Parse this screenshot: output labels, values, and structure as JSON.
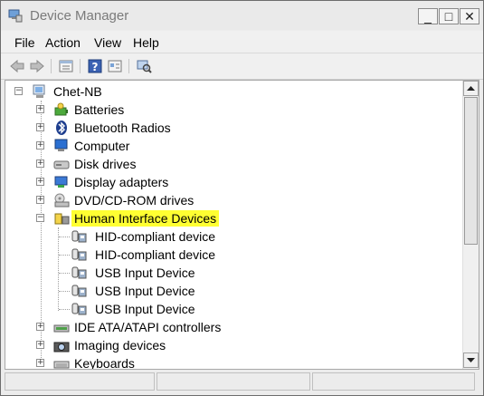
{
  "window": {
    "title": "Device Manager"
  },
  "window_controls": [
    "_",
    "□",
    "✕"
  ],
  "menu": [
    "File",
    "Action",
    "View",
    "Help"
  ],
  "toolbar": [
    "back",
    "forward",
    "properties",
    "help",
    "show-hidden",
    "scan-hardware"
  ],
  "tree": [
    {
      "label": "Chet-NB",
      "level": 0,
      "expander": "-",
      "icon": "computer-root-icon"
    },
    {
      "label": "Batteries",
      "level": 1,
      "expander": "+",
      "icon": "battery-icon"
    },
    {
      "label": "Bluetooth Radios",
      "level": 1,
      "expander": "+",
      "icon": "bluetooth-icon"
    },
    {
      "label": "Computer",
      "level": 1,
      "expander": "+",
      "icon": "computer-icon"
    },
    {
      "label": "Disk drives",
      "level": 1,
      "expander": "+",
      "icon": "disk-drive-icon"
    },
    {
      "label": "Display adapters",
      "level": 1,
      "expander": "+",
      "icon": "display-adapter-icon"
    },
    {
      "label": "DVD/CD-ROM drives",
      "level": 1,
      "expander": "+",
      "icon": "dvd-drive-icon"
    },
    {
      "label": "Human Interface Devices",
      "level": 1,
      "expander": "-",
      "icon": "hid-icon",
      "selected": true
    },
    {
      "label": "HID-compliant device",
      "level": 2,
      "icon": "hid-device-icon"
    },
    {
      "label": "HID-compliant device",
      "level": 2,
      "icon": "hid-device-icon"
    },
    {
      "label": "USB Input Device",
      "level": 2,
      "icon": "hid-device-icon"
    },
    {
      "label": "USB Input Device",
      "level": 2,
      "icon": "hid-device-icon"
    },
    {
      "label": "USB Input Device",
      "level": 2,
      "icon": "hid-device-icon"
    },
    {
      "label": "IDE ATA/ATAPI controllers",
      "level": 1,
      "expander": "+",
      "icon": "ide-controller-icon"
    },
    {
      "label": "Imaging devices",
      "level": 1,
      "expander": "+",
      "icon": "camera-icon"
    },
    {
      "label": "Keyboards",
      "level": 1,
      "expander": "+",
      "icon": "keyboard-icon"
    }
  ],
  "colors": {
    "selection": "#ffff32"
  }
}
